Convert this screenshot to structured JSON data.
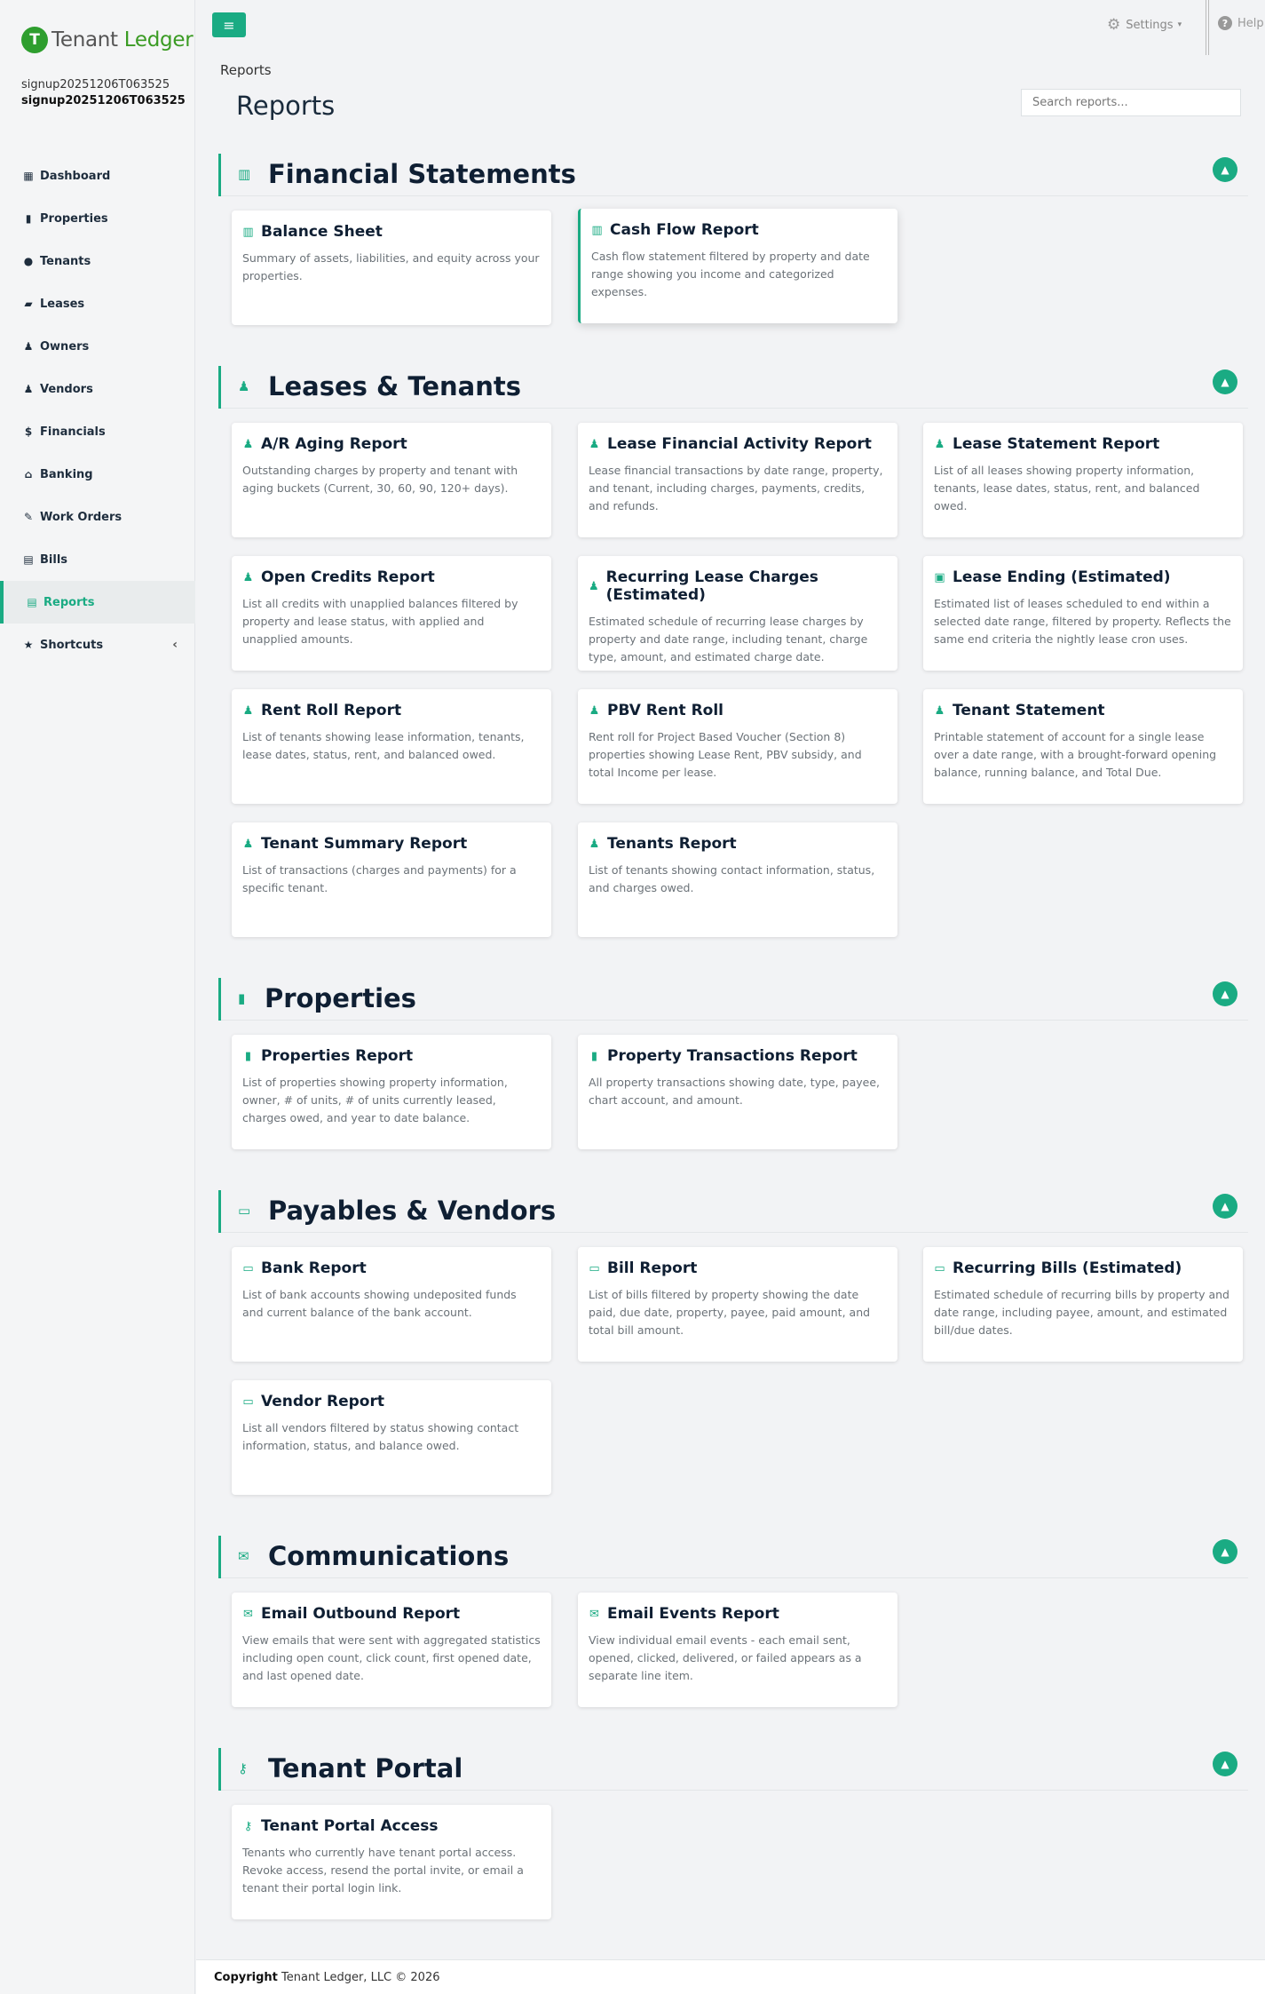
{
  "app": {
    "logo_left": "Tenant",
    "logo_right": "Ledger",
    "user_line1": "signup20251206T063525",
    "user_line2": "signup20251206T063525"
  },
  "sidebar": {
    "items": [
      {
        "label": "Dashboard",
        "icon": "dashboard-icon"
      },
      {
        "label": "Properties",
        "icon": "building-icon"
      },
      {
        "label": "Tenants",
        "icon": "user-icon"
      },
      {
        "label": "Leases",
        "icon": "folder-icon"
      },
      {
        "label": "Owners",
        "icon": "users-icon"
      },
      {
        "label": "Vendors",
        "icon": "users-icon"
      },
      {
        "label": "Financials",
        "icon": "dollar-icon"
      },
      {
        "label": "Banking",
        "icon": "bank-icon"
      },
      {
        "label": "Work Orders",
        "icon": "edit-icon"
      },
      {
        "label": "Bills",
        "icon": "file-icon"
      },
      {
        "label": "Reports",
        "icon": "file-icon",
        "active": true
      },
      {
        "label": "Shortcuts",
        "icon": "star-icon"
      }
    ]
  },
  "topbar": {
    "settings_label": "Settings",
    "help_label": "Help"
  },
  "breadcrumb": "Reports",
  "page_title": "Reports",
  "search": {
    "placeholder": "Search reports..."
  },
  "sections": [
    {
      "title": "Financial Statements",
      "icon": "bar-chart-icon",
      "cards": [
        {
          "title": "Balance Sheet",
          "desc": "Summary of assets, liabilities, and equity across your properties."
        },
        {
          "title": "Cash Flow Report",
          "desc": "Cash flow statement filtered by property and date range showing you income and categorized expenses."
        }
      ]
    },
    {
      "title": "Leases & Tenants",
      "icon": "users-icon",
      "cards": [
        {
          "title": "A/R Aging Report",
          "desc": "Outstanding charges by property and tenant with aging buckets (Current, 30, 60, 90, 120+ days)."
        },
        {
          "title": "Lease Financial Activity Report",
          "desc": "Lease financial transactions by date range, property, and tenant, including charges, payments, credits, and refunds."
        },
        {
          "title": "Lease Statement Report",
          "desc": "List of all leases showing property information, tenants, lease dates, status, rent, and balanced owed."
        },
        {
          "title": "Open Credits Report",
          "desc": "List all credits with unapplied balances filtered by property and lease status, with applied and unapplied amounts."
        },
        {
          "title": "Recurring Lease Charges (Estimated)",
          "desc": "Estimated schedule of recurring lease charges by property and date range, including tenant, charge type, amount, and estimated charge date."
        },
        {
          "title": "Lease Ending (Estimated)",
          "desc": "Estimated list of leases scheduled to end within a selected date range, filtered by property. Reflects the same end criteria the nightly lease cron uses."
        },
        {
          "title": "Rent Roll Report",
          "desc": "List of tenants showing lease information, tenants, lease dates, status, rent, and balanced owed."
        },
        {
          "title": "PBV Rent Roll",
          "desc": "Rent roll for Project Based Voucher (Section 8) properties showing Lease Rent, PBV subsidy, and total Income per lease."
        },
        {
          "title": "Tenant Statement",
          "desc": "Printable statement of account for a single lease over a date range, with a brought-forward opening balance, running balance, and Total Due."
        },
        {
          "title": "Tenant Summary Report",
          "desc": "List of transactions (charges and payments) for a specific tenant."
        },
        {
          "title": "Tenants Report",
          "desc": "List of tenants showing contact information, status, and charges owed."
        }
      ]
    },
    {
      "title": "Properties",
      "icon": "building-icon",
      "cards": [
        {
          "title": "Properties Report",
          "desc": "List of properties showing property information, owner, # of units, # of units currently leased, charges owed, and year to date balance."
        },
        {
          "title": "Property Transactions Report",
          "desc": "All property transactions showing date, type, payee, chart account, and amount."
        }
      ]
    },
    {
      "title": "Payables & Vendors",
      "icon": "credit-card-icon",
      "cards": [
        {
          "title": "Bank Report",
          "desc": "List of bank accounts showing undeposited funds and current balance of the bank account."
        },
        {
          "title": "Bill Report",
          "desc": "List of bills filtered by property showing the date paid, due date, property, payee, paid amount, and total bill amount."
        },
        {
          "title": "Recurring Bills (Estimated)",
          "desc": "Estimated schedule of recurring bills by property and date range, including payee, amount, and estimated bill/due dates."
        },
        {
          "title": "Vendor Report",
          "desc": "List all vendors filtered by status showing contact information, status, and balance owed."
        }
      ]
    },
    {
      "title": "Communications",
      "icon": "envelope-icon",
      "cards": [
        {
          "title": "Email Outbound Report",
          "desc": "View emails that were sent with aggregated statistics including open count, click count, first opened date, and last opened date."
        },
        {
          "title": "Email Events Report",
          "desc": "View individual email events - each email sent, opened, clicked, delivered, or failed appears as a separate line item."
        }
      ]
    },
    {
      "title": "Tenant Portal",
      "icon": "key-icon",
      "cards": [
        {
          "title": "Tenant Portal Access",
          "desc": "Tenants who currently have tenant portal access. Revoke access, resend the portal invite, or email a tenant their portal login link."
        }
      ]
    }
  ],
  "footer": {
    "copyright_bold": "Copyright",
    "copyright_rest": "Tenant Ledger, LLC © 2026"
  },
  "colors": {
    "accent": "#1aab83",
    "logo_green": "#3a9b23"
  }
}
